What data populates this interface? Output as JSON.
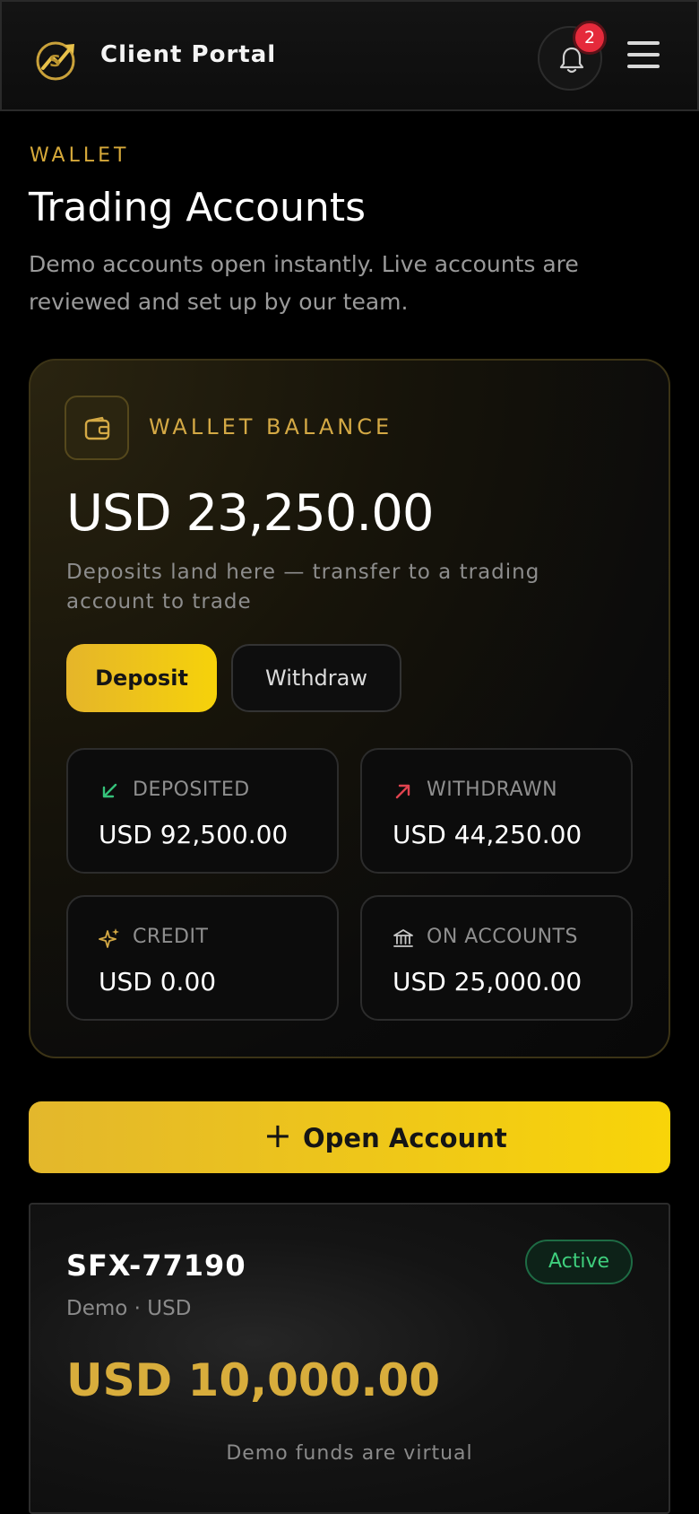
{
  "header": {
    "title": "Client Portal",
    "notification_count": "2",
    "logo_icon": "trend-arrow-logo",
    "bell_icon": "bell-icon",
    "menu_icon": "hamburger-menu-icon"
  },
  "page": {
    "eyebrow": "WALLET",
    "title": "Trading Accounts",
    "description": "Demo accounts open instantly. Live accounts are reviewed and set up by our team."
  },
  "wallet": {
    "label": "WALLET BALANCE",
    "amount": "USD 23,250.00",
    "note": "Deposits land here — transfer to a trading account to trade",
    "deposit_label": "Deposit",
    "withdraw_label": "Withdraw",
    "stats": [
      {
        "label": "DEPOSITED",
        "value": "USD 92,500.00",
        "icon": "arrow-down-left-icon",
        "color": "#35c27a"
      },
      {
        "label": "WITHDRAWN",
        "value": "USD 44,250.00",
        "icon": "arrow-up-right-icon",
        "color": "#e0434f"
      },
      {
        "label": "CREDIT",
        "value": "USD 0.00",
        "icon": "sparkle-icon",
        "color": "#d4a945"
      },
      {
        "label": "ON ACCOUNTS",
        "value": "USD 25,000.00",
        "icon": "bank-icon",
        "color": "#c8c8c8"
      }
    ]
  },
  "open_account": {
    "label": "Open Account",
    "plus": "+"
  },
  "accounts": [
    {
      "id": "SFX-77190",
      "meta": "Demo · USD",
      "status": "Active",
      "balance": "USD 10,000.00",
      "note": "Demo funds are virtual"
    }
  ],
  "colors": {
    "accent": "#f6d20a",
    "gold": "#d4a945",
    "success": "#3fcf7d",
    "danger": "#e52a3b"
  }
}
